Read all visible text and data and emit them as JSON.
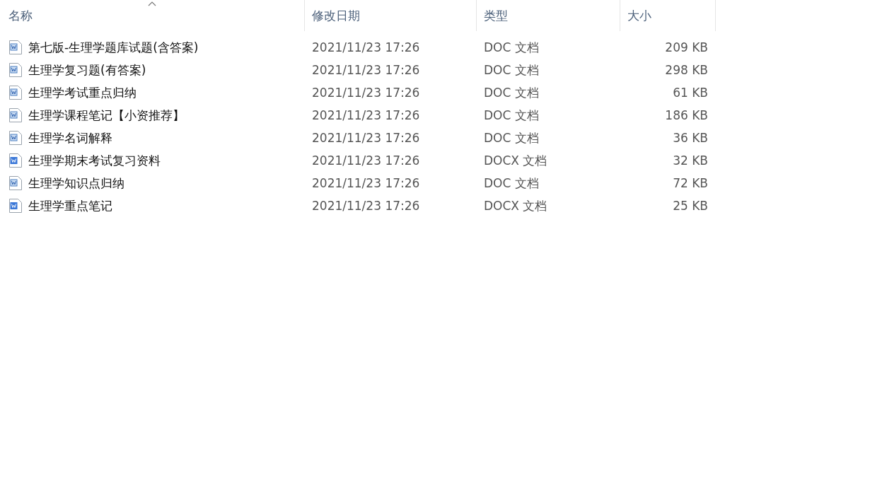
{
  "columns": [
    {
      "label": "名称",
      "sorted": true
    },
    {
      "label": "修改日期",
      "sorted": false
    },
    {
      "label": "类型",
      "sorted": false
    },
    {
      "label": "大小",
      "sorted": false
    }
  ],
  "files": [
    {
      "kind": "doc",
      "name": "第七版-生理学题库试题(含答案)",
      "modified": "2021/11/23 17:26",
      "type": "DOC 文档",
      "size": "209 KB"
    },
    {
      "kind": "doc",
      "name": "生理学复习题(有答案)",
      "modified": "2021/11/23 17:26",
      "type": "DOC 文档",
      "size": "298 KB"
    },
    {
      "kind": "doc",
      "name": "生理学考试重点归纳",
      "modified": "2021/11/23 17:26",
      "type": "DOC 文档",
      "size": "61 KB"
    },
    {
      "kind": "doc",
      "name": "生理学课程笔记【小资推荐】",
      "modified": "2021/11/23 17:26",
      "type": "DOC 文档",
      "size": "186 KB"
    },
    {
      "kind": "doc",
      "name": "生理学名词解释",
      "modified": "2021/11/23 17:26",
      "type": "DOC 文档",
      "size": "36 KB"
    },
    {
      "kind": "docx",
      "name": "生理学期末考试复习资料",
      "modified": "2021/11/23 17:26",
      "type": "DOCX 文档",
      "size": "32 KB"
    },
    {
      "kind": "doc",
      "name": "生理学知识点归纳",
      "modified": "2021/11/23 17:26",
      "type": "DOC 文档",
      "size": "72 KB"
    },
    {
      "kind": "docx",
      "name": "生理学重点笔记",
      "modified": "2021/11/23 17:26",
      "type": "DOCX 文档",
      "size": "25 KB"
    }
  ]
}
